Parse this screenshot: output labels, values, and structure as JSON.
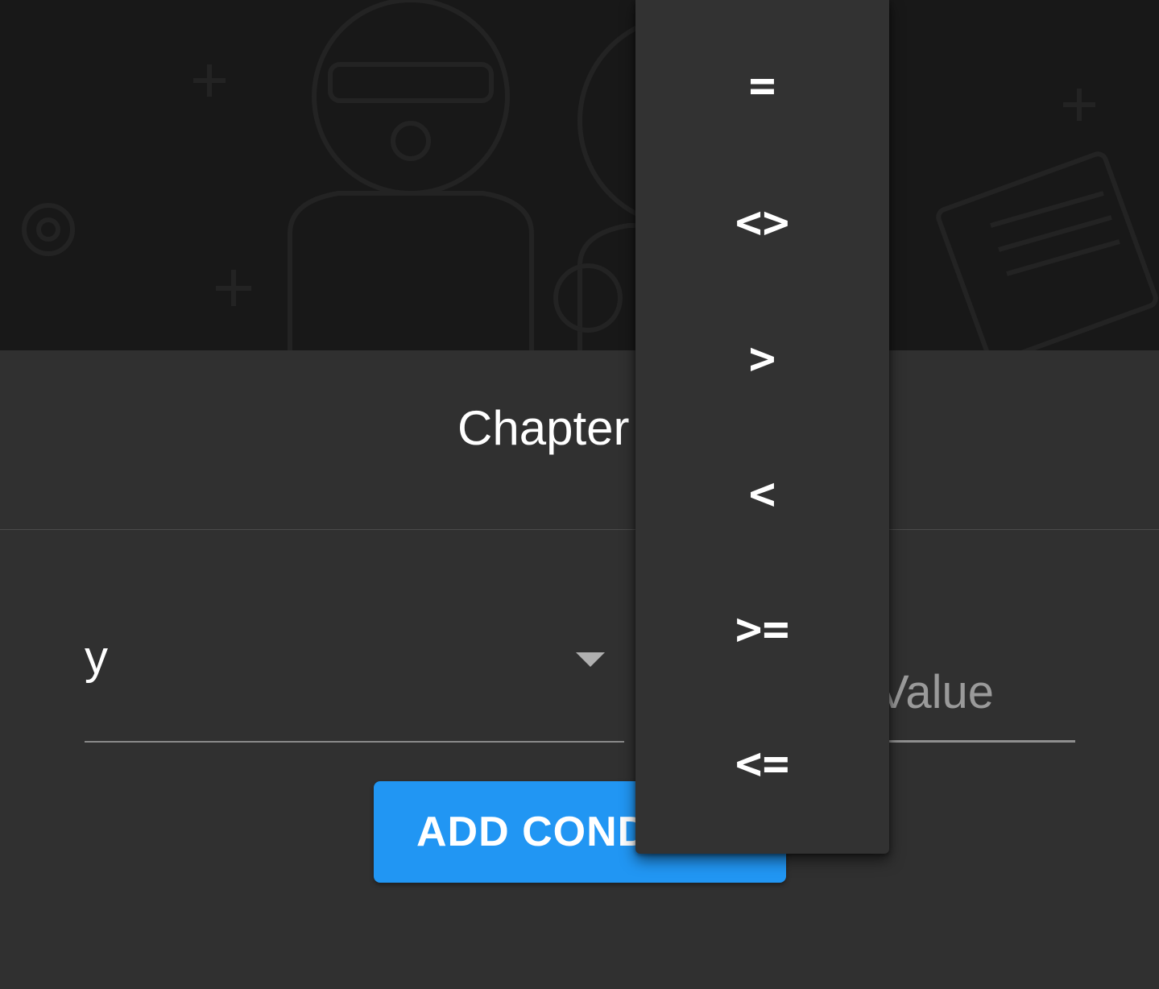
{
  "dialog": {
    "title": "Chapter",
    "field": {
      "value": "y"
    },
    "value_input": {
      "placeholder": "Value"
    },
    "add_button_label": "ADD CONDITION"
  },
  "operator_menu": {
    "items": [
      {
        "label": "="
      },
      {
        "label": "<>"
      },
      {
        "label": ">"
      },
      {
        "label": "<"
      },
      {
        "label": ">="
      },
      {
        "label": "<="
      }
    ]
  },
  "colors": {
    "background": "#303030",
    "banner": "#181818",
    "menu": "#323232",
    "accent": "#2196f3"
  }
}
